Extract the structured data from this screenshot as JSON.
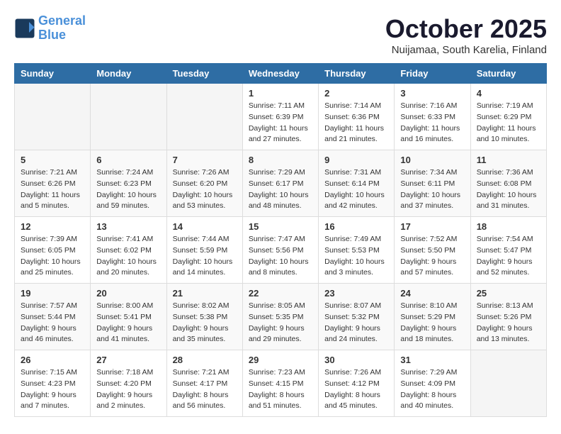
{
  "header": {
    "logo_line1": "General",
    "logo_line2": "Blue",
    "month": "October 2025",
    "location": "Nuijamaa, South Karelia, Finland"
  },
  "weekdays": [
    "Sunday",
    "Monday",
    "Tuesday",
    "Wednesday",
    "Thursday",
    "Friday",
    "Saturday"
  ],
  "weeks": [
    [
      {
        "day": "",
        "info": ""
      },
      {
        "day": "",
        "info": ""
      },
      {
        "day": "",
        "info": ""
      },
      {
        "day": "1",
        "info": "Sunrise: 7:11 AM\nSunset: 6:39 PM\nDaylight: 11 hours\nand 27 minutes."
      },
      {
        "day": "2",
        "info": "Sunrise: 7:14 AM\nSunset: 6:36 PM\nDaylight: 11 hours\nand 21 minutes."
      },
      {
        "day": "3",
        "info": "Sunrise: 7:16 AM\nSunset: 6:33 PM\nDaylight: 11 hours\nand 16 minutes."
      },
      {
        "day": "4",
        "info": "Sunrise: 7:19 AM\nSunset: 6:29 PM\nDaylight: 11 hours\nand 10 minutes."
      }
    ],
    [
      {
        "day": "5",
        "info": "Sunrise: 7:21 AM\nSunset: 6:26 PM\nDaylight: 11 hours\nand 5 minutes."
      },
      {
        "day": "6",
        "info": "Sunrise: 7:24 AM\nSunset: 6:23 PM\nDaylight: 10 hours\nand 59 minutes."
      },
      {
        "day": "7",
        "info": "Sunrise: 7:26 AM\nSunset: 6:20 PM\nDaylight: 10 hours\nand 53 minutes."
      },
      {
        "day": "8",
        "info": "Sunrise: 7:29 AM\nSunset: 6:17 PM\nDaylight: 10 hours\nand 48 minutes."
      },
      {
        "day": "9",
        "info": "Sunrise: 7:31 AM\nSunset: 6:14 PM\nDaylight: 10 hours\nand 42 minutes."
      },
      {
        "day": "10",
        "info": "Sunrise: 7:34 AM\nSunset: 6:11 PM\nDaylight: 10 hours\nand 37 minutes."
      },
      {
        "day": "11",
        "info": "Sunrise: 7:36 AM\nSunset: 6:08 PM\nDaylight: 10 hours\nand 31 minutes."
      }
    ],
    [
      {
        "day": "12",
        "info": "Sunrise: 7:39 AM\nSunset: 6:05 PM\nDaylight: 10 hours\nand 25 minutes."
      },
      {
        "day": "13",
        "info": "Sunrise: 7:41 AM\nSunset: 6:02 PM\nDaylight: 10 hours\nand 20 minutes."
      },
      {
        "day": "14",
        "info": "Sunrise: 7:44 AM\nSunset: 5:59 PM\nDaylight: 10 hours\nand 14 minutes."
      },
      {
        "day": "15",
        "info": "Sunrise: 7:47 AM\nSunset: 5:56 PM\nDaylight: 10 hours\nand 8 minutes."
      },
      {
        "day": "16",
        "info": "Sunrise: 7:49 AM\nSunset: 5:53 PM\nDaylight: 10 hours\nand 3 minutes."
      },
      {
        "day": "17",
        "info": "Sunrise: 7:52 AM\nSunset: 5:50 PM\nDaylight: 9 hours\nand 57 minutes."
      },
      {
        "day": "18",
        "info": "Sunrise: 7:54 AM\nSunset: 5:47 PM\nDaylight: 9 hours\nand 52 minutes."
      }
    ],
    [
      {
        "day": "19",
        "info": "Sunrise: 7:57 AM\nSunset: 5:44 PM\nDaylight: 9 hours\nand 46 minutes."
      },
      {
        "day": "20",
        "info": "Sunrise: 8:00 AM\nSunset: 5:41 PM\nDaylight: 9 hours\nand 41 minutes."
      },
      {
        "day": "21",
        "info": "Sunrise: 8:02 AM\nSunset: 5:38 PM\nDaylight: 9 hours\nand 35 minutes."
      },
      {
        "day": "22",
        "info": "Sunrise: 8:05 AM\nSunset: 5:35 PM\nDaylight: 9 hours\nand 29 minutes."
      },
      {
        "day": "23",
        "info": "Sunrise: 8:07 AM\nSunset: 5:32 PM\nDaylight: 9 hours\nand 24 minutes."
      },
      {
        "day": "24",
        "info": "Sunrise: 8:10 AM\nSunset: 5:29 PM\nDaylight: 9 hours\nand 18 minutes."
      },
      {
        "day": "25",
        "info": "Sunrise: 8:13 AM\nSunset: 5:26 PM\nDaylight: 9 hours\nand 13 minutes."
      }
    ],
    [
      {
        "day": "26",
        "info": "Sunrise: 7:15 AM\nSunset: 4:23 PM\nDaylight: 9 hours\nand 7 minutes."
      },
      {
        "day": "27",
        "info": "Sunrise: 7:18 AM\nSunset: 4:20 PM\nDaylight: 9 hours\nand 2 minutes."
      },
      {
        "day": "28",
        "info": "Sunrise: 7:21 AM\nSunset: 4:17 PM\nDaylight: 8 hours\nand 56 minutes."
      },
      {
        "day": "29",
        "info": "Sunrise: 7:23 AM\nSunset: 4:15 PM\nDaylight: 8 hours\nand 51 minutes."
      },
      {
        "day": "30",
        "info": "Sunrise: 7:26 AM\nSunset: 4:12 PM\nDaylight: 8 hours\nand 45 minutes."
      },
      {
        "day": "31",
        "info": "Sunrise: 7:29 AM\nSunset: 4:09 PM\nDaylight: 8 hours\nand 40 minutes."
      },
      {
        "day": "",
        "info": ""
      }
    ]
  ]
}
